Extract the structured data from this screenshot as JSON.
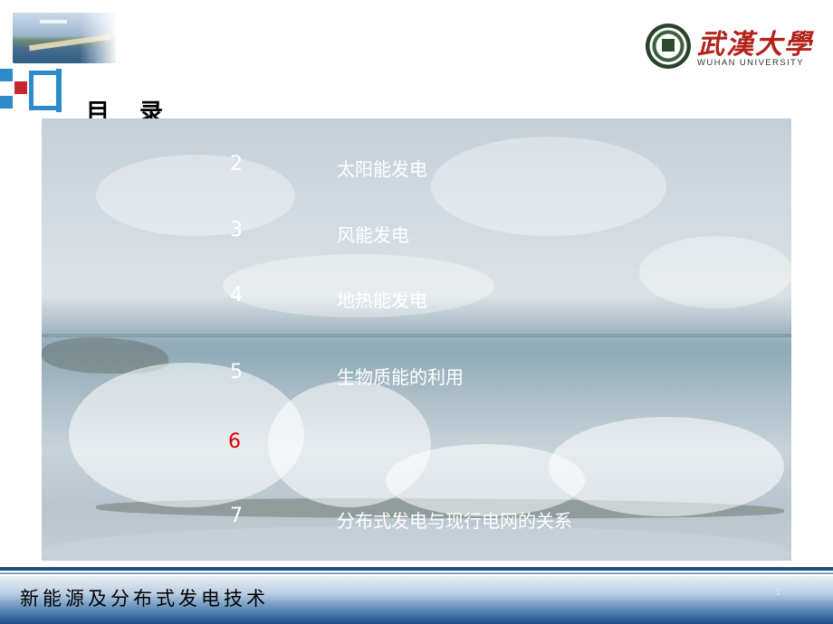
{
  "header": {
    "logo_cn": "武漢大學",
    "logo_en": "WUHAN UNIVERSITY"
  },
  "title": "目 录",
  "toc": [
    {
      "num": "2",
      "label": "太阳能发电"
    },
    {
      "num": "3",
      "label": "风能发电"
    },
    {
      "num": "4",
      "label": "地热能发电"
    },
    {
      "num": "5",
      "label": "生物质能的利用"
    },
    {
      "num": "6",
      "label": ""
    },
    {
      "num": "7",
      "label": "分布式发电与现行电网的关系"
    }
  ],
  "footer": {
    "text": "新能源及分布式发电技术",
    "page_number": "1"
  },
  "colors": {
    "highlight_number": "#e00000",
    "logo_red": "#b3221b",
    "footer_blue": "#1f4f86",
    "deco_blue": "#2e8bc9",
    "deco_red": "#c8262e"
  },
  "icons": [
    "university-emblem-icon",
    "header-photo",
    "decorative-squares-icon"
  ]
}
